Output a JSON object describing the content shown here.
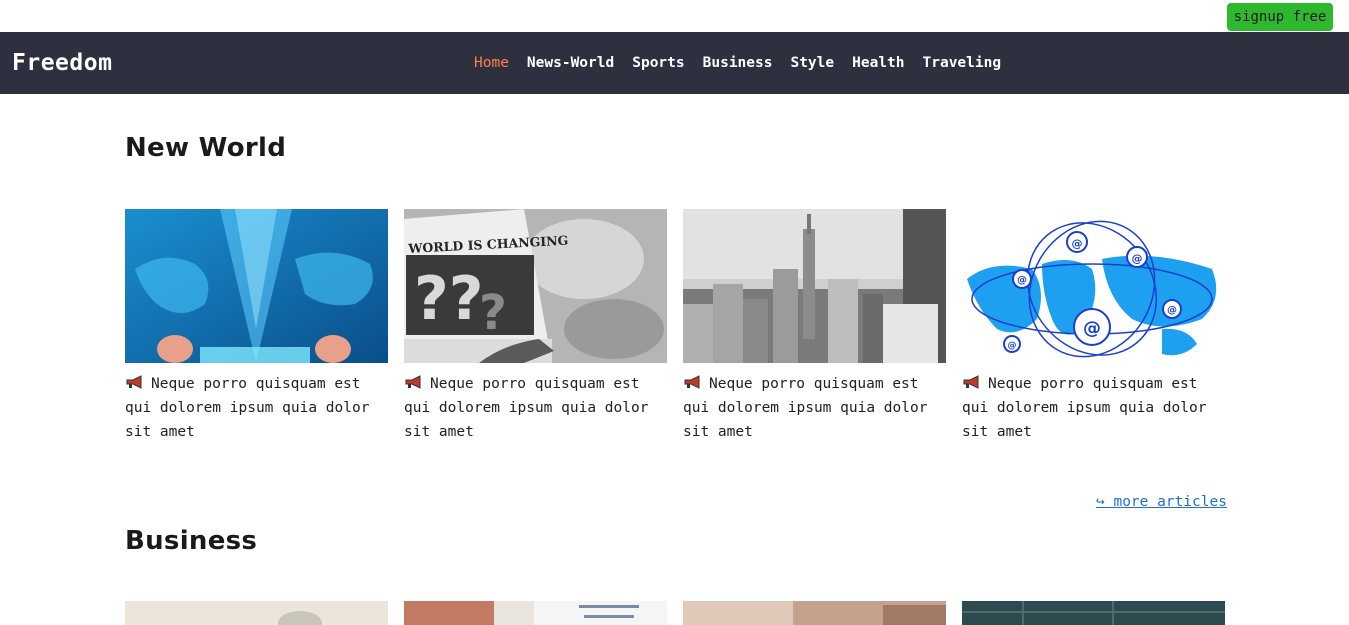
{
  "header": {
    "signup_label": "signup free"
  },
  "navbar": {
    "logo": "Freedom",
    "links": [
      "Home",
      "News-World",
      "Sports",
      "Business",
      "Style",
      "Health",
      "Traveling"
    ],
    "active": "Home"
  },
  "sections": {
    "world": {
      "title": "New World",
      "cards": [
        {
          "image": "businessman-world-map",
          "text": "Neque porro quisquam est qui dolorem ipsum quia dolor sit amet"
        },
        {
          "image": "newspaper-world-is-changing",
          "text": "Neque porro quisquam est qui dolorem ipsum quia dolor sit amet"
        },
        {
          "image": "city-skyline-bw",
          "text": "Neque porro quisquam est qui dolorem ipsum quia dolor sit amet"
        },
        {
          "image": "global-email-network-map",
          "text": "Neque porro quisquam est qui dolorem ipsum quia dolor sit amet"
        }
      ],
      "more_link": "↪ more articles"
    },
    "business": {
      "title": "Business"
    }
  },
  "images": {
    "newspaper_headline": "WORLD IS CHANGING"
  },
  "colors": {
    "navbar_bg": "#2e3040",
    "active_link": "#ff7f50",
    "signup_bg": "#2eb82e",
    "link": "#1e6fd9"
  },
  "icons": {
    "card_bullet": "megaphone-icon"
  }
}
